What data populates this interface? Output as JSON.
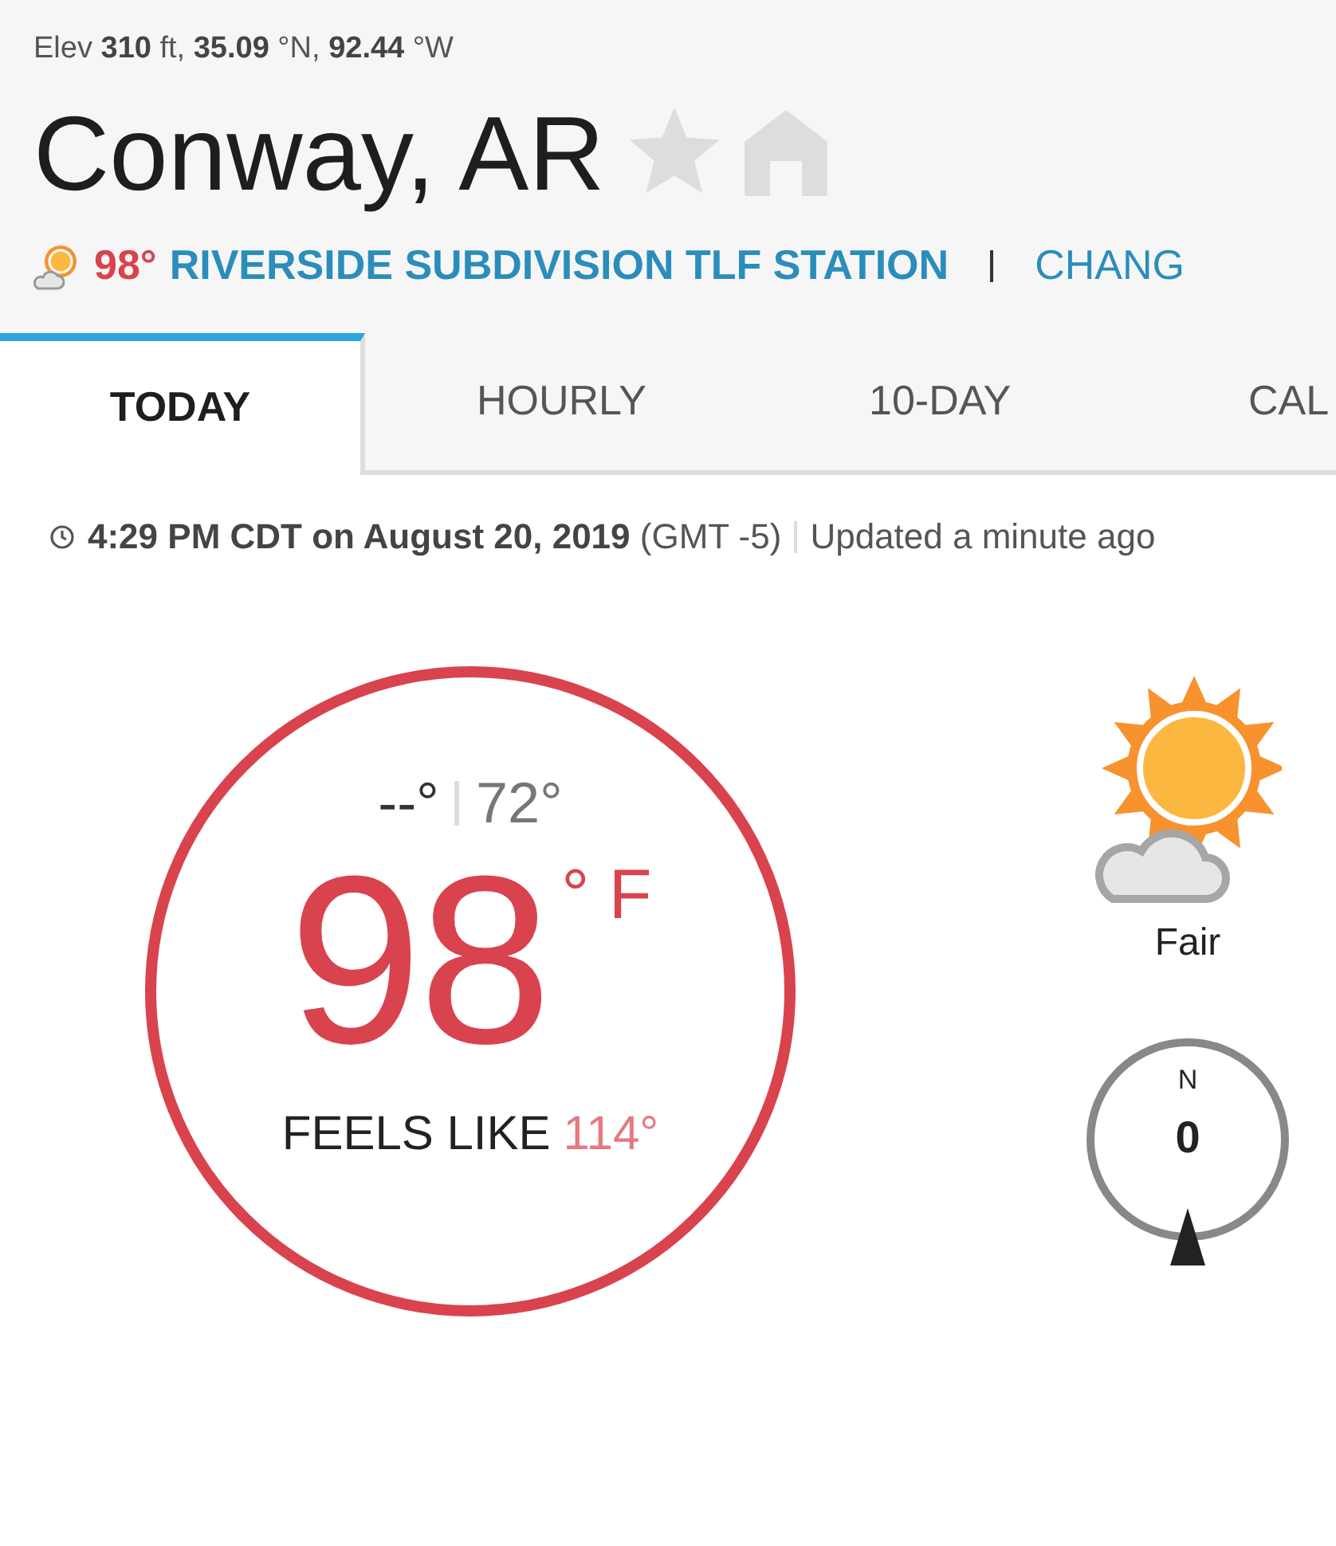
{
  "header": {
    "coordinates": "Elev **310** ft, **35.09** °N, **92.44** °W",
    "title": "Conway, AR",
    "station": {
      "temperature": "98°",
      "name": "RIVERSIDE SUBDIVISION TLF STATION",
      "change_link": "CHANG"
    }
  },
  "tabs": [
    {
      "label": "TODAY",
      "selected": true
    },
    {
      "label": "HOURLY",
      "selected": false
    },
    {
      "label": "10-DAY",
      "selected": false
    },
    {
      "label": "CAL",
      "selected": false
    }
  ],
  "timestamp": {
    "time": "**4:29 PM CDT on August 20, 2019** (GMT -5)",
    "updated": "Updated a minute ago"
  },
  "current": {
    "high": "--°",
    "low": "72°",
    "temperature": "98",
    "unit": "° F",
    "feels_label": "FEELS LIKE",
    "feels_value": "114°"
  },
  "condition": {
    "label": "Fair"
  },
  "wind": {
    "direction": "N",
    "speed": "0"
  }
}
